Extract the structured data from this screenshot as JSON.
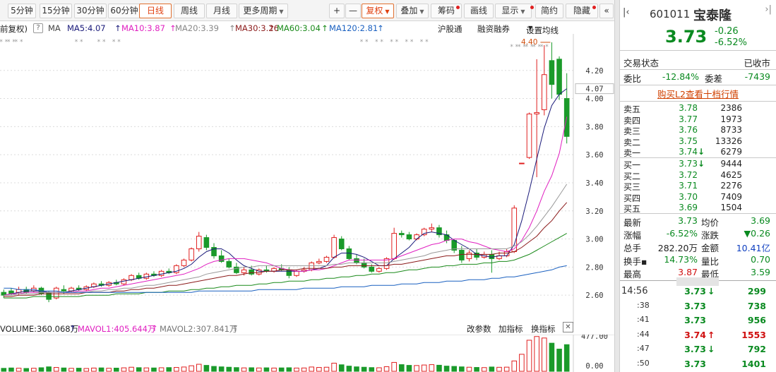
{
  "toolbar": {
    "periods": [
      "5分钟",
      "15分钟",
      "30分钟",
      "60分钟",
      "日线",
      "周线",
      "月线",
      "更多周期"
    ],
    "active_period": "日线",
    "plus": "+",
    "minus": "—",
    "fuquan": "复权",
    "diejia": "叠加",
    "chouma": "筹码",
    "huaxian": "画线",
    "xianshi": "显示",
    "jianyue": "简约",
    "yincang": "隐藏",
    "expand": "«"
  },
  "ma_line": {
    "prefix": "前复权)",
    "help": "?",
    "ma": "MA",
    "ma5": "MA5:4.07",
    "ma10": "MA10:3.87",
    "ma20": "MA20:3.39",
    "ma30": "MA30:3.26",
    "ma60": "MA60:3.04",
    "ma120": "MA120:2.81",
    "hugutong": "沪股通",
    "rongzi": "融资融券",
    "settings": "设置均线"
  },
  "colors": {
    "up": "#e02020",
    "down": "#1a9a2a",
    "ma5": "#1a1a7a",
    "ma10": "#e020c0",
    "ma20": "#999999",
    "ma30": "#8b1a1a",
    "ma60": "#1a8a1a",
    "ma120": "#1a60c0"
  },
  "chart_data": {
    "type": "candlestick",
    "ylim": [
      2.45,
      4.45
    ],
    "y_ticks": [
      "4.20",
      "4.00",
      "3.80",
      "3.60",
      "3.40",
      "3.20",
      "3.00",
      "2.80",
      "2.60"
    ],
    "current_ma5_tag": "4.07",
    "max_marker": "4.40",
    "candles": [
      [
        2.62,
        2.64,
        2.6,
        2.58
      ],
      [
        2.63,
        2.65,
        2.61,
        2.6
      ],
      [
        2.62,
        2.66,
        2.64,
        2.6
      ],
      [
        2.64,
        2.66,
        2.62,
        2.61
      ],
      [
        2.63,
        2.67,
        2.65,
        2.62
      ],
      [
        2.65,
        2.66,
        2.61,
        2.6
      ],
      [
        2.62,
        2.63,
        2.57,
        2.55
      ],
      [
        2.58,
        2.66,
        2.65,
        2.57
      ],
      [
        2.64,
        2.67,
        2.63,
        2.61
      ],
      [
        2.63,
        2.66,
        2.65,
        2.62
      ],
      [
        2.65,
        2.67,
        2.64,
        2.63
      ],
      [
        2.64,
        2.67,
        2.66,
        2.63
      ],
      [
        2.66,
        2.69,
        2.68,
        2.65
      ],
      [
        2.68,
        2.7,
        2.67,
        2.66
      ],
      [
        2.67,
        2.7,
        2.69,
        2.66
      ],
      [
        2.69,
        2.71,
        2.68,
        2.67
      ],
      [
        2.68,
        2.72,
        2.71,
        2.67
      ],
      [
        2.71,
        2.75,
        2.74,
        2.7
      ],
      [
        2.74,
        2.76,
        2.72,
        2.71
      ],
      [
        2.72,
        2.76,
        2.75,
        2.71
      ],
      [
        2.75,
        2.77,
        2.74,
        2.73
      ],
      [
        2.74,
        2.78,
        2.77,
        2.73
      ],
      [
        2.77,
        2.79,
        2.76,
        2.75
      ],
      [
        2.76,
        2.82,
        2.81,
        2.75
      ],
      [
        2.81,
        2.86,
        2.85,
        2.8
      ],
      [
        2.85,
        2.94,
        2.93,
        2.84
      ],
      [
        2.93,
        3.05,
        3.02,
        2.91
      ],
      [
        3.01,
        3.03,
        2.94,
        2.92
      ],
      [
        2.94,
        2.97,
        2.88,
        2.86
      ],
      [
        2.88,
        2.92,
        2.84,
        2.83
      ],
      [
        2.84,
        2.86,
        2.8,
        2.79
      ],
      [
        2.8,
        2.83,
        2.76,
        2.75
      ],
      [
        2.76,
        2.8,
        2.78,
        2.74
      ],
      [
        2.78,
        2.81,
        2.75,
        2.74
      ],
      [
        2.75,
        2.79,
        2.78,
        2.74
      ],
      [
        2.78,
        2.81,
        2.77,
        2.76
      ],
      [
        2.77,
        2.8,
        2.79,
        2.76
      ],
      [
        2.79,
        2.82,
        2.78,
        2.77
      ],
      [
        2.78,
        2.8,
        2.74,
        2.72
      ],
      [
        2.74,
        2.78,
        2.77,
        2.73
      ],
      [
        2.77,
        2.8,
        2.78,
        2.76
      ],
      [
        2.78,
        2.84,
        2.83,
        2.77
      ],
      [
        2.83,
        2.86,
        2.84,
        2.82
      ],
      [
        2.84,
        2.88,
        2.87,
        2.83
      ],
      [
        2.87,
        3.03,
        3.01,
        2.86
      ],
      [
        3.0,
        3.02,
        2.93,
        2.92
      ],
      [
        2.93,
        2.95,
        2.86,
        2.85
      ],
      [
        2.86,
        2.89,
        2.83,
        2.82
      ],
      [
        2.83,
        2.86,
        2.8,
        2.79
      ],
      [
        2.8,
        2.82,
        2.77,
        2.76
      ],
      [
        2.77,
        2.8,
        2.79,
        2.76
      ],
      [
        2.79,
        2.87,
        2.86,
        2.78
      ],
      [
        2.86,
        3.08,
        3.04,
        2.85
      ],
      [
        3.04,
        3.06,
        3.03,
        3.01
      ],
      [
        3.03,
        3.05,
        3.0,
        2.99
      ],
      [
        3.0,
        3.04,
        3.03,
        2.99
      ],
      [
        3.03,
        3.08,
        3.07,
        3.02
      ],
      [
        3.07,
        3.11,
        3.08,
        3.05
      ],
      [
        3.08,
        3.1,
        3.03,
        3.01
      ],
      [
        3.03,
        3.06,
        2.99,
        2.97
      ],
      [
        2.99,
        3.0,
        2.92,
        2.9
      ],
      [
        2.92,
        2.95,
        2.85,
        2.83
      ],
      [
        2.86,
        2.92,
        2.9,
        2.84
      ],
      [
        2.9,
        2.93,
        2.87,
        2.85
      ],
      [
        2.87,
        2.91,
        2.89,
        2.86
      ],
      [
        2.89,
        2.92,
        2.86,
        2.76
      ],
      [
        2.86,
        2.91,
        2.88,
        2.85
      ],
      [
        2.88,
        2.93,
        2.91,
        2.87
      ],
      [
        2.91,
        3.24,
        3.22,
        2.9
      ],
      [
        3.54,
        3.54,
        3.54,
        3.54
      ],
      [
        3.58,
        3.9,
        3.89,
        3.57
      ],
      [
        3.89,
        4.28,
        3.9,
        3.44
      ],
      [
        3.92,
        4.38,
        4.17,
        3.88
      ],
      [
        4.27,
        4.4,
        4.1,
        4.0
      ],
      [
        4.28,
        4.3,
        4.03,
        3.99
      ],
      [
        4.0,
        4.18,
        3.73,
        3.68
      ]
    ],
    "ma_series": {
      "ma5": [
        2.6,
        2.61,
        2.62,
        2.63,
        2.63,
        2.63,
        2.62,
        2.62,
        2.62,
        2.63,
        2.64,
        2.65,
        2.66,
        2.67,
        2.68,
        2.69,
        2.7,
        2.71,
        2.72,
        2.73,
        2.74,
        2.75,
        2.76,
        2.77,
        2.79,
        2.82,
        2.87,
        2.91,
        2.93,
        2.93,
        2.9,
        2.85,
        2.81,
        2.79,
        2.77,
        2.77,
        2.77,
        2.77,
        2.77,
        2.77,
        2.77,
        2.78,
        2.79,
        2.81,
        2.87,
        2.9,
        2.9,
        2.89,
        2.87,
        2.84,
        2.81,
        2.81,
        2.86,
        2.9,
        2.94,
        3.0,
        3.04,
        3.05,
        3.04,
        3.03,
        2.99,
        2.96,
        2.93,
        2.89,
        2.88,
        2.87,
        2.88,
        2.88,
        2.96,
        3.13,
        3.34,
        3.57,
        3.79,
        3.95,
        4.03,
        4.07
      ],
      "ma10": [
        2.6,
        2.61,
        2.61,
        2.62,
        2.62,
        2.62,
        2.62,
        2.62,
        2.62,
        2.62,
        2.63,
        2.63,
        2.64,
        2.65,
        2.65,
        2.66,
        2.67,
        2.68,
        2.69,
        2.7,
        2.71,
        2.72,
        2.73,
        2.74,
        2.75,
        2.77,
        2.79,
        2.82,
        2.84,
        2.85,
        2.86,
        2.86,
        2.86,
        2.85,
        2.84,
        2.83,
        2.81,
        2.79,
        2.78,
        2.77,
        2.77,
        2.78,
        2.78,
        2.79,
        2.81,
        2.83,
        2.85,
        2.85,
        2.85,
        2.85,
        2.85,
        2.85,
        2.86,
        2.88,
        2.9,
        2.92,
        2.94,
        2.96,
        2.97,
        2.99,
        3.0,
        3.0,
        2.98,
        2.97,
        2.95,
        2.93,
        2.92,
        2.91,
        2.93,
        2.99,
        3.08,
        3.2,
        3.34,
        3.45,
        3.61,
        3.87
      ],
      "ma20": [
        2.6,
        2.6,
        2.61,
        2.61,
        2.61,
        2.62,
        2.62,
        2.62,
        2.62,
        2.62,
        2.62,
        2.62,
        2.63,
        2.63,
        2.64,
        2.64,
        2.65,
        2.65,
        2.66,
        2.67,
        2.67,
        2.68,
        2.69,
        2.7,
        2.71,
        2.72,
        2.73,
        2.75,
        2.76,
        2.77,
        2.78,
        2.79,
        2.8,
        2.8,
        2.81,
        2.81,
        2.81,
        2.81,
        2.81,
        2.81,
        2.81,
        2.81,
        2.81,
        2.81,
        2.82,
        2.82,
        2.83,
        2.83,
        2.83,
        2.83,
        2.83,
        2.83,
        2.84,
        2.85,
        2.86,
        2.87,
        2.88,
        2.9,
        2.91,
        2.92,
        2.93,
        2.93,
        2.93,
        2.93,
        2.93,
        2.93,
        2.93,
        2.93,
        2.95,
        2.98,
        3.03,
        3.09,
        3.16,
        3.23,
        3.31,
        3.39
      ],
      "ma30": [
        2.59,
        2.59,
        2.6,
        2.6,
        2.6,
        2.61,
        2.61,
        2.61,
        2.61,
        2.61,
        2.61,
        2.62,
        2.62,
        2.62,
        2.62,
        2.63,
        2.63,
        2.64,
        2.64,
        2.65,
        2.65,
        2.66,
        2.67,
        2.67,
        2.68,
        2.69,
        2.7,
        2.71,
        2.72,
        2.73,
        2.74,
        2.74,
        2.75,
        2.76,
        2.76,
        2.77,
        2.77,
        2.78,
        2.78,
        2.78,
        2.79,
        2.79,
        2.79,
        2.79,
        2.8,
        2.8,
        2.81,
        2.81,
        2.81,
        2.81,
        2.81,
        2.81,
        2.82,
        2.82,
        2.83,
        2.84,
        2.85,
        2.86,
        2.87,
        2.88,
        2.88,
        2.89,
        2.89,
        2.89,
        2.89,
        2.89,
        2.9,
        2.9,
        2.91,
        2.94,
        2.98,
        3.02,
        3.08,
        3.13,
        3.2,
        3.26
      ],
      "ma60": [
        2.58,
        2.58,
        2.58,
        2.58,
        2.59,
        2.59,
        2.59,
        2.59,
        2.59,
        2.59,
        2.59,
        2.6,
        2.6,
        2.6,
        2.6,
        2.61,
        2.61,
        2.61,
        2.61,
        2.62,
        2.62,
        2.62,
        2.63,
        2.63,
        2.63,
        2.64,
        2.64,
        2.65,
        2.65,
        2.66,
        2.66,
        2.67,
        2.67,
        2.67,
        2.68,
        2.68,
        2.69,
        2.69,
        2.7,
        2.7,
        2.7,
        2.71,
        2.71,
        2.72,
        2.72,
        2.73,
        2.73,
        2.74,
        2.74,
        2.75,
        2.75,
        2.76,
        2.76,
        2.77,
        2.78,
        2.78,
        2.79,
        2.8,
        2.8,
        2.81,
        2.81,
        2.82,
        2.82,
        2.82,
        2.83,
        2.83,
        2.84,
        2.84,
        2.85,
        2.87,
        2.89,
        2.92,
        2.95,
        2.98,
        3.01,
        3.04
      ],
      "ma120": [
        2.65,
        2.65,
        2.64,
        2.64,
        2.64,
        2.63,
        2.63,
        2.63,
        2.62,
        2.62,
        2.62,
        2.62,
        2.62,
        2.62,
        2.62,
        2.62,
        2.62,
        2.62,
        2.62,
        2.62,
        2.62,
        2.62,
        2.62,
        2.62,
        2.62,
        2.62,
        2.63,
        2.63,
        2.63,
        2.63,
        2.63,
        2.63,
        2.63,
        2.63,
        2.64,
        2.64,
        2.64,
        2.64,
        2.64,
        2.64,
        2.65,
        2.65,
        2.65,
        2.65,
        2.65,
        2.66,
        2.66,
        2.66,
        2.66,
        2.67,
        2.67,
        2.67,
        2.67,
        2.68,
        2.68,
        2.68,
        2.69,
        2.69,
        2.69,
        2.7,
        2.7,
        2.7,
        2.71,
        2.71,
        2.71,
        2.72,
        2.72,
        2.73,
        2.73,
        2.74,
        2.75,
        2.76,
        2.77,
        2.78,
        2.8,
        2.81
      ]
    },
    "volume": {
      "title": "VOLUME:360.068万",
      "mavol1": "MAVOL1:405.644万",
      "mavol2": "MAVOL2:307.841万",
      "y_ticks": [
        "477.00",
        "0.00"
      ],
      "ylim": [
        0,
        477
      ],
      "values": [
        40,
        45,
        42,
        38,
        41,
        48,
        60,
        52,
        45,
        40,
        42,
        38,
        44,
        46,
        41,
        43,
        47,
        55,
        49,
        46,
        45,
        48,
        50,
        52,
        58,
        75,
        95,
        80,
        66,
        60,
        55,
        50,
        46,
        48,
        45,
        47,
        44,
        46,
        48,
        44,
        45,
        58,
        52,
        55,
        110,
        88,
        70,
        60,
        55,
        50,
        48,
        62,
        120,
        90,
        80,
        78,
        85,
        90,
        82,
        70,
        66,
        60,
        55,
        52,
        50,
        58,
        54,
        56,
        140,
        230,
        420,
        470,
        450,
        380,
        300,
        360
      ]
    }
  },
  "vol_actions": {
    "gaicanshu": "改参数",
    "jiazhibiao": "加指标",
    "huanzhibiao": "换指标",
    "close": "✕"
  },
  "panel": {
    "code": "601011",
    "name": "宝泰隆",
    "price": "3.73",
    "change": "-0.26",
    "change_pct": "-6.52%",
    "status_label": "交易状态",
    "status_value": "已收市",
    "weibi_label": "委比",
    "weibi_value": "-12.84%",
    "weicha_label": "委差",
    "weicha_value": "-7439",
    "l2_link": "购买L2查看十档行情",
    "asks": [
      {
        "label": "卖五",
        "price": "3.78",
        "vol": "2386",
        "arrow": ""
      },
      {
        "label": "卖四",
        "price": "3.77",
        "vol": "1973",
        "arrow": ""
      },
      {
        "label": "卖三",
        "price": "3.76",
        "vol": "8733",
        "arrow": ""
      },
      {
        "label": "卖二",
        "price": "3.75",
        "vol": "13326",
        "arrow": ""
      },
      {
        "label": "卖一",
        "price": "3.74",
        "vol": "6279",
        "arrow": "↓"
      }
    ],
    "bids": [
      {
        "label": "买一",
        "price": "3.73",
        "vol": "9444",
        "arrow": "↓"
      },
      {
        "label": "买二",
        "price": "3.72",
        "vol": "4625",
        "arrow": ""
      },
      {
        "label": "买三",
        "price": "3.71",
        "vol": "2276",
        "arrow": ""
      },
      {
        "label": "买四",
        "price": "3.70",
        "vol": "7409",
        "arrow": ""
      },
      {
        "label": "买五",
        "price": "3.69",
        "vol": "1504",
        "arrow": ""
      }
    ],
    "stats": [
      {
        "l1": "最新",
        "v1": "3.73",
        "c1": "green",
        "l2": "均价",
        "v2": "3.69",
        "c2": "green"
      },
      {
        "l1": "涨幅",
        "v1": "-6.52%",
        "c1": "green",
        "l2": "涨跌",
        "v2": "▼0.26",
        "c2": "green"
      },
      {
        "l1": "总手",
        "v1": "282.20万",
        "c1": "black",
        "l2": "金额",
        "v2": "10.41亿",
        "c2": "blue"
      },
      {
        "l1": "换手▪",
        "v1": "14.73%",
        "c1": "green",
        "l2": "量比",
        "v2": "0.70",
        "c2": "green"
      },
      {
        "l1": "最高",
        "v1": "3.87",
        "c1": "red",
        "l2": "最低",
        "v2": "3.59",
        "c2": "green"
      }
    ],
    "ticks": [
      {
        "time": "14:56",
        "price": "3.73",
        "arrow": "↓",
        "arrow_color": "green",
        "vol": "299",
        "vol_color": "green"
      },
      {
        "time": ":38",
        "price": "3.73",
        "arrow": "",
        "arrow_color": "",
        "vol": "738",
        "vol_color": "green"
      },
      {
        "time": ":41",
        "price": "3.73",
        "arrow": "",
        "arrow_color": "",
        "vol": "956",
        "vol_color": "green"
      },
      {
        "time": ":44",
        "price": "3.74",
        "arrow": "↑",
        "arrow_color": "red",
        "vol": "1553",
        "vol_color": "red"
      },
      {
        "time": ":47",
        "price": "3.73",
        "arrow": "↓",
        "arrow_color": "green",
        "vol": "792",
        "vol_color": "green"
      },
      {
        "time": ":50",
        "price": "3.73",
        "arrow": "",
        "arrow_color": "",
        "vol": "1401",
        "vol_color": "green"
      }
    ]
  }
}
